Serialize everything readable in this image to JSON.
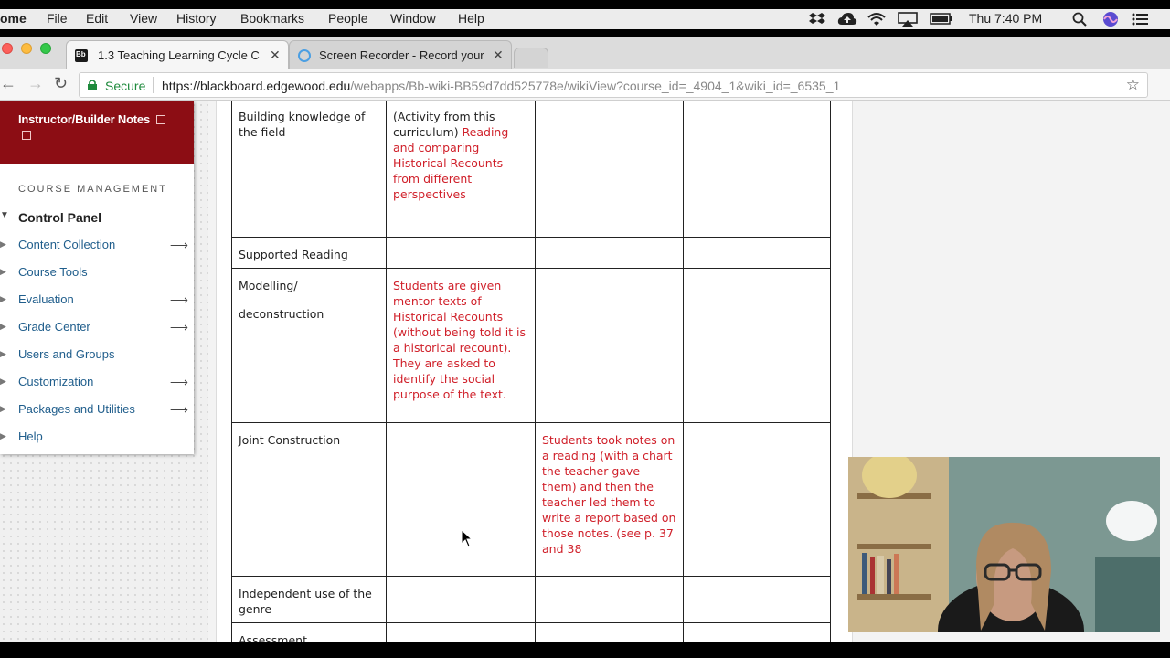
{
  "menubar": {
    "app": "ome",
    "items": [
      "File",
      "Edit",
      "View",
      "History",
      "Bookmarks",
      "People",
      "Window",
      "Help"
    ],
    "clock": "Thu 7:40 PM"
  },
  "tabs": [
    {
      "title": "1.3 Teaching Learning Cycle C",
      "favicon": "Bb"
    },
    {
      "title": "Screen Recorder - Record your"
    }
  ],
  "address_bar": {
    "secure_label": "Secure",
    "url_host": "https://blackboard.edgewood.edu",
    "url_path": "/webapps/Bb-wiki-BB59d7dd525778e/wikiView?course_id=_4904_1&wiki_id=_6535_1"
  },
  "sidebar": {
    "header_title": "Instructor/Builder Notes",
    "section_label": "COURSE MANAGEMENT",
    "control_panel": "Control Panel",
    "items": [
      {
        "label": "Content Collection",
        "has_arrow": true
      },
      {
        "label": "Course Tools",
        "has_arrow": false
      },
      {
        "label": "Evaluation",
        "has_arrow": true
      },
      {
        "label": "Grade Center",
        "has_arrow": true
      },
      {
        "label": "Users and Groups",
        "has_arrow": false
      },
      {
        "label": "Customization",
        "has_arrow": true
      },
      {
        "label": "Packages and Utilities",
        "has_arrow": true
      },
      {
        "label": "Help",
        "has_arrow": false
      }
    ]
  },
  "table": {
    "rows": [
      {
        "stage": "Building knowledge of the field",
        "col2_prefix": "(Activity from this curriculum) ",
        "col2": "Reading and comparing Historical Recounts from different perspectives",
        "col3": ""
      },
      {
        "stage": "Supported Reading",
        "col2_prefix": "",
        "col2": "",
        "col3": ""
      },
      {
        "stage": "Modelling/",
        "stage_cont": "deconstruction",
        "col2_prefix": "",
        "col2": "Students are given mentor texts of Historical Recounts (without being told it is a historical recount). They are asked to identify the social purpose of the text.",
        "col3": ""
      },
      {
        "stage": "Joint Construction",
        "col2_prefix": "",
        "col2": "",
        "col3": "Students took notes on a reading (with a chart the teacher gave them) and then the teacher led them to write a report based on those notes. (see p. 37 and 38"
      },
      {
        "stage": "Independent use of the genre",
        "col2_prefix": "",
        "col2": "",
        "col3": ""
      },
      {
        "stage": "Assessment",
        "col2_prefix": "",
        "col2": "",
        "col3": ""
      }
    ]
  },
  "colors": {
    "sidebar_header": "#8c0d14",
    "link": "#205e8c",
    "annotation_red": "#d0202a",
    "secure_green": "#1e8a3c"
  }
}
